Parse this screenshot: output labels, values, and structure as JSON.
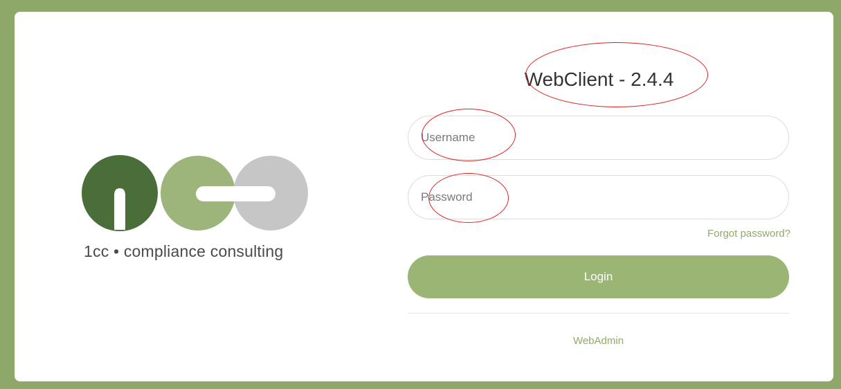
{
  "brand": {
    "logo_text": "1cc • compliance consulting",
    "colors": {
      "dark_green": "#4a6e3a",
      "light_green": "#9db57a",
      "grey": "#c6c6c6",
      "frame": "#8ea869",
      "accent": "#9bb574"
    }
  },
  "login": {
    "title": "WebClient - 2.4.4",
    "username_placeholder": "Username",
    "password_placeholder": "Password",
    "forgot_label": "Forgot password?",
    "login_label": "Login",
    "webadmin_label": "WebAdmin"
  },
  "annotations": {
    "color": "#e02020",
    "marked": [
      "title",
      "username",
      "password"
    ]
  }
}
